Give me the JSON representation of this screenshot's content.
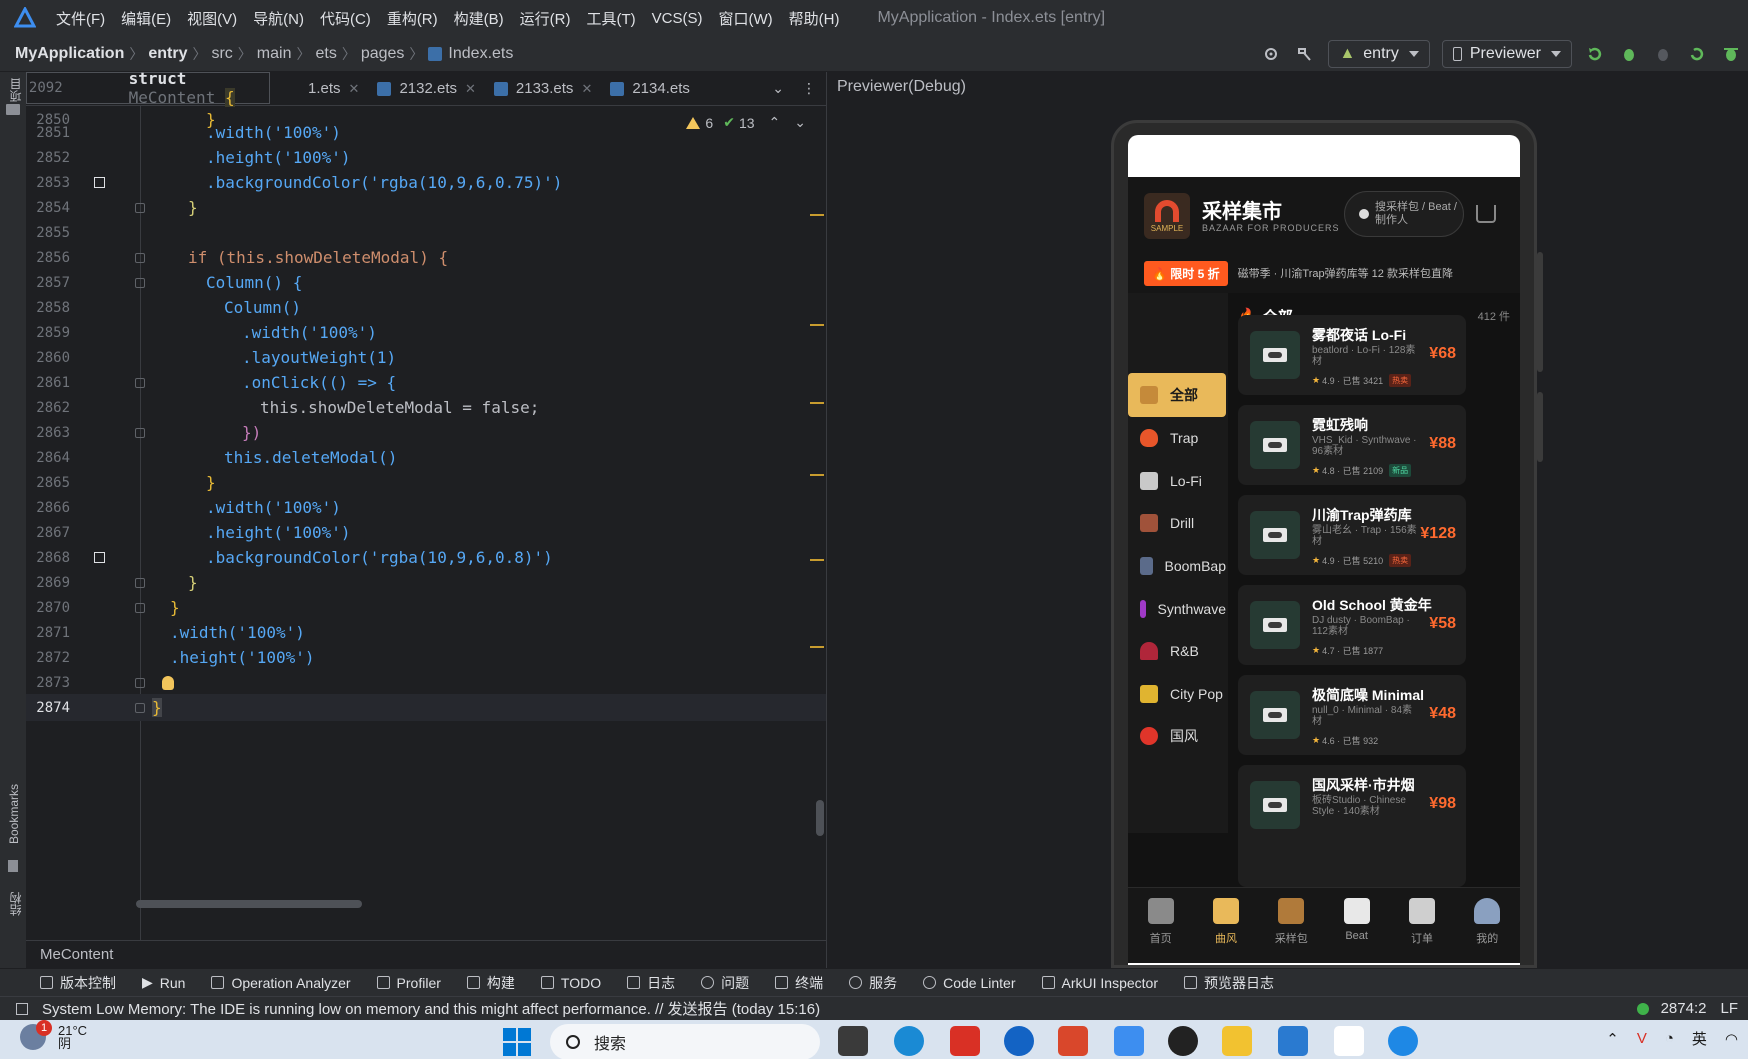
{
  "menubar": {
    "items": [
      "文件(F)",
      "编辑(E)",
      "视图(V)",
      "导航(N)",
      "代码(C)",
      "重构(R)",
      "构建(B)",
      "运行(R)",
      "工具(T)",
      "VCS(S)",
      "窗口(W)",
      "帮助(H)"
    ],
    "window_title": "MyApplication - Index.ets [entry]"
  },
  "navbar": {
    "breadcrumb": [
      "MyApplication",
      "entry",
      "src",
      "main",
      "ets",
      "pages",
      "Index.ets"
    ],
    "module_combo": "entry",
    "device_combo": "Previewer"
  },
  "left_strip": {
    "project_label": "项目",
    "bookmarks_label": "Bookmarks",
    "structure_label": "结构"
  },
  "editor": {
    "sticky_line_number": "2092",
    "sticky_code_keyword": "struct",
    "sticky_code_name": "MeContent",
    "sticky_code_brace": "{",
    "tabs": [
      {
        "label": "1.ets"
      },
      {
        "label": "2132.ets"
      },
      {
        "label": "2133.ets"
      },
      {
        "label": "2134.ets"
      }
    ],
    "warnings": "6",
    "checks": "13",
    "lines": [
      {
        "n": "2851",
        "t": ".width('100%')"
      },
      {
        "n": "2852",
        "t": ".height('100%')"
      },
      {
        "n": "2853",
        "t": ".backgroundColor('rgba(10,9,6,0.75)')"
      },
      {
        "n": "2854",
        "t": "}"
      },
      {
        "n": "2855",
        "t": ""
      },
      {
        "n": "2856",
        "t": "if (this.showDeleteModal) {"
      },
      {
        "n": "2857",
        "t": "Column() {"
      },
      {
        "n": "2858",
        "t": "Column()"
      },
      {
        "n": "2859",
        "t": ".width('100%')"
      },
      {
        "n": "2860",
        "t": ".layoutWeight(1)"
      },
      {
        "n": "2861",
        "t": ".onClick(() => {"
      },
      {
        "n": "2862",
        "t": "this.showDeleteModal = false;"
      },
      {
        "n": "2863",
        "t": "})"
      },
      {
        "n": "2864",
        "t": "this.deleteModal()"
      },
      {
        "n": "2865",
        "t": "}"
      },
      {
        "n": "2866",
        "t": ".width('100%')"
      },
      {
        "n": "2867",
        "t": ".height('100%')"
      },
      {
        "n": "2868",
        "t": ".backgroundColor('rgba(10,9,6,0.8)')"
      },
      {
        "n": "2869",
        "t": "}"
      },
      {
        "n": "2870",
        "t": "}"
      },
      {
        "n": "2871",
        "t": ".width('100%')"
      },
      {
        "n": "2872",
        "t": ".height('100%')"
      },
      {
        "n": "2873",
        "t": "}"
      },
      {
        "n": "2874",
        "t": "}"
      }
    ],
    "scope_breadcrumb": "MeContent"
  },
  "preview": {
    "title": "Previewer(Debug)",
    "app": {
      "title": "采样集市",
      "subtitle": "BAZAAR FOR PRODUCERS",
      "logo_label": "SAMPLE",
      "search_placeholder": "搜采样包 / Beat / 制作人",
      "promo_badge": "🔥 限时 5 折",
      "promo_text": "磁带季 · 川渝Trap弹药库等 12 款采样包直降",
      "categories": [
        "全部",
        "Trap",
        "Lo-Fi",
        "Drill",
        "BoomBap",
        "Synthwave",
        "R&B",
        "City Pop",
        "国风"
      ],
      "section_title": "全部",
      "section_count": "412 件",
      "products": [
        {
          "name": "雾都夜话 Lo-Fi",
          "meta": "beatlord · Lo-Fi · 128素材",
          "rating": "4.9",
          "sold": "已售 3421",
          "tag": "热卖",
          "price": "¥68"
        },
        {
          "name": "霓虹残响",
          "meta": "VHS_Kid · Synthwave · 96素材",
          "rating": "4.8",
          "sold": "已售 2109",
          "tag": "新品",
          "price": "¥88"
        },
        {
          "name": "川渝Trap弹药库",
          "meta": "雾山老幺 · Trap · 156素材",
          "rating": "4.9",
          "sold": "已售 5210",
          "tag": "热卖",
          "price": "¥128"
        },
        {
          "name": "Old School 黄金年",
          "meta": "DJ dusty · BoomBap · 112素材",
          "rating": "4.7",
          "sold": "已售 1877",
          "tag": "",
          "price": "¥58"
        },
        {
          "name": "极简底噪 Minimal",
          "meta": "null_0 · Minimal · 84素材",
          "rating": "4.6",
          "sold": "已售 932",
          "tag": "",
          "price": "¥48"
        },
        {
          "name": "国风采样·市井烟",
          "meta": "板砖Studio · Chinese Style · 140素材",
          "rating": "",
          "sold": "",
          "tag": "",
          "price": "¥98"
        }
      ],
      "bottom_nav": [
        "首页",
        "曲风",
        "采样包",
        "Beat",
        "订单",
        "我的"
      ],
      "bottom_nav_active": "曲风"
    }
  },
  "tool_windows": [
    "版本控制",
    "Run",
    "Operation Analyzer",
    "Profiler",
    "构建",
    "TODO",
    "日志",
    "问题",
    "终端",
    "服务",
    "Code Linter",
    "ArkUI Inspector",
    "预览器日志"
  ],
  "status": {
    "message": "System Low Memory: The IDE is running low on memory and this might affect performance. // 发送报告 (today 15:16)",
    "position": "2874:2",
    "line_sep": "LF"
  },
  "taskbar": {
    "temperature": "21°C",
    "weather": "阴",
    "weather_badge": "1",
    "search_placeholder": "搜索",
    "ime": "英"
  },
  "colors": {
    "accent_gold": "#e9b95a",
    "price_orange": "#ff6a2f",
    "ide_bg": "#1e1f22"
  }
}
